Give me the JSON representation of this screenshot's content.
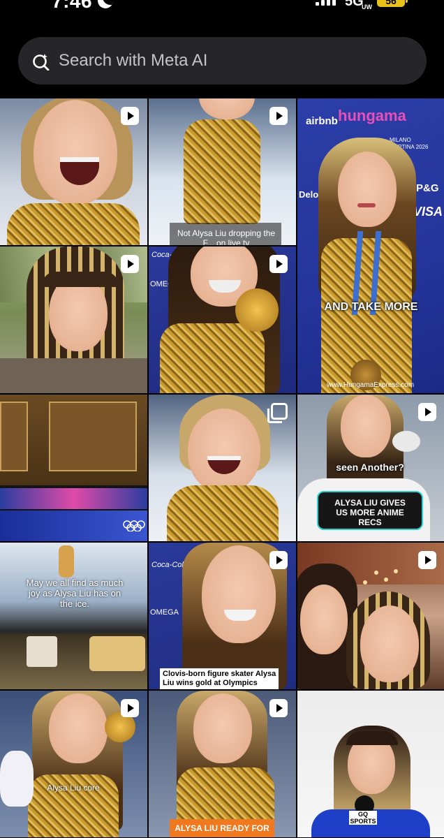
{
  "status": {
    "time": "7:46",
    "network": "5G",
    "network_sub": "UW",
    "battery": "56"
  },
  "search": {
    "placeholder": "Search with Meta AI"
  },
  "tiles": [
    {
      "caption": ""
    },
    {
      "caption": "Not Alysa Liu dropping the F... on live tv"
    },
    {
      "caption": "AND TAKE MORE",
      "logo_text": "hungama",
      "badge_text": "www.HungamaExpress.com"
    },
    {
      "caption": ""
    },
    {
      "caption": ""
    },
    {
      "caption": ""
    },
    {
      "caption": ""
    },
    {
      "caption": "seen Another?",
      "caption2": "ALYSA LIU GIVES US MORE ANIME RECS"
    },
    {
      "caption": "May we all find as much joy as Alysa Liu has on the ice."
    },
    {
      "caption": "Clovis-born figure skater Alysa Liu wins gold at Olympics"
    },
    {
      "caption": ""
    },
    {
      "caption": "Alysa Liu core"
    },
    {
      "caption": "ALYSA LIU READY FOR"
    },
    {
      "caption": "",
      "logo_text": "GQ SPORTS"
    }
  ],
  "sponsors": {
    "coca_cola": "Coca-Cola",
    "omega": "OMEGA",
    "airbnb": "airbnb",
    "visa": "VISA",
    "deloitte": "Deloitte",
    "pg": "P&G",
    "milano": "MILANO CORTINA 2026"
  }
}
